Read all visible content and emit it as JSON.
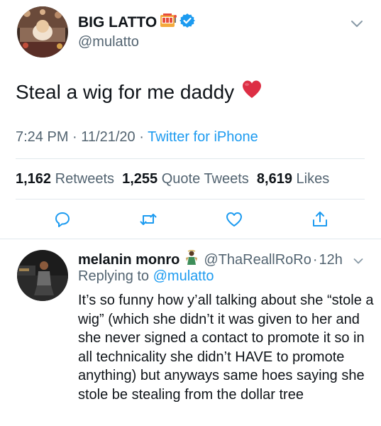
{
  "main_tweet": {
    "display_name": "BIG LATTO",
    "name_emoji": "slot-machine-emoji",
    "verified_icon": "verified-badge-icon",
    "handle": "@mulatto",
    "text": "Steal a wig for me daddy",
    "text_emoji": "red-heart-emoji",
    "time": "7:24 PM",
    "separator_1": "·",
    "date": "11/21/20",
    "separator_2": "·",
    "source": "Twitter for iPhone",
    "stats": {
      "retweets_count": "1,162",
      "retweets_label": "Retweets",
      "quotes_count": "1,255",
      "quotes_label": "Quote Tweets",
      "likes_count": "8,619",
      "likes_label": "Likes"
    },
    "actions": [
      "reply-icon",
      "retweet-icon",
      "like-icon",
      "share-icon"
    ]
  },
  "reply": {
    "display_name": "melanin monro",
    "name_emoji": "person-emoji",
    "handle": "@ThaReallRoRo",
    "separator": "·",
    "time": "12h",
    "replying_prefix": "Replying to",
    "replying_to": "@mulatto",
    "text": "It’s so funny how y’all talking about she “stole a wig” (which she didn’t it was given to her and she never signed a contact to promote it so in all technicality she didn’t HAVE to promote anything) but anyways same hoes saying she stole be stealing from the dollar tree"
  },
  "colors": {
    "primary_text": "#0f1419",
    "secondary_text": "#536471",
    "link": "#1d9bf0",
    "verified": "#1d9bf0",
    "divider": "#e1e8ed",
    "heart": "#e0245e"
  }
}
